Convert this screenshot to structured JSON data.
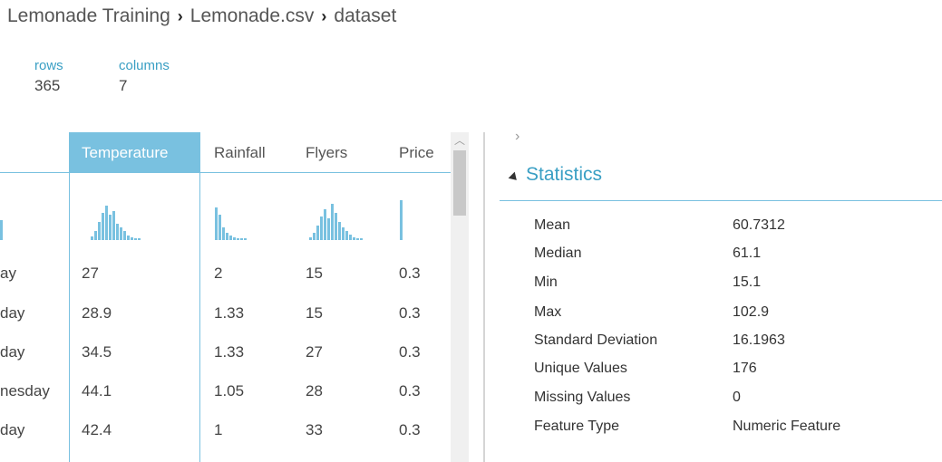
{
  "breadcrumb": {
    "items": [
      "Lemonade Training",
      "Lemonade.csv",
      "dataset"
    ]
  },
  "dimensions": {
    "rows_label": "rows",
    "rows_value": "365",
    "cols_label": "columns",
    "cols_value": "7"
  },
  "table": {
    "columns": [
      "Temperature",
      "Rainfall",
      "Flyers",
      "Price"
    ],
    "selected_column": "Temperature",
    "row_labels": [
      "ay",
      "day",
      "day",
      "nesday",
      "day"
    ],
    "rows": [
      [
        "27",
        "2",
        "15",
        "0.3"
      ],
      [
        "28.9",
        "1.33",
        "15",
        "0.3"
      ],
      [
        "34.5",
        "1.33",
        "27",
        "0.3"
      ],
      [
        "44.1",
        "1.05",
        "28",
        "0.3"
      ],
      [
        "42.4",
        "1",
        "33",
        "0.3"
      ]
    ]
  },
  "icons": {
    "expand": "chevron-right-icon",
    "collapse": "collapse-triangle-icon",
    "scroll_up": "chevron-up-icon"
  },
  "statistics": {
    "title": "Statistics",
    "items": [
      {
        "key": "Mean",
        "value": "60.7312"
      },
      {
        "key": "Median",
        "value": "61.1"
      },
      {
        "key": "Min",
        "value": "15.1"
      },
      {
        "key": "Max",
        "value": "102.9"
      },
      {
        "key": "Standard Deviation",
        "value": "16.1963"
      },
      {
        "key": "Unique Values",
        "value": "176"
      },
      {
        "key": "Missing Values",
        "value": "0"
      },
      {
        "key": "Feature Type",
        "value": "Numeric Feature"
      }
    ]
  },
  "colors": {
    "accent": "#79c1e0",
    "accent_text": "#3a9fc4",
    "text": "#333333"
  }
}
